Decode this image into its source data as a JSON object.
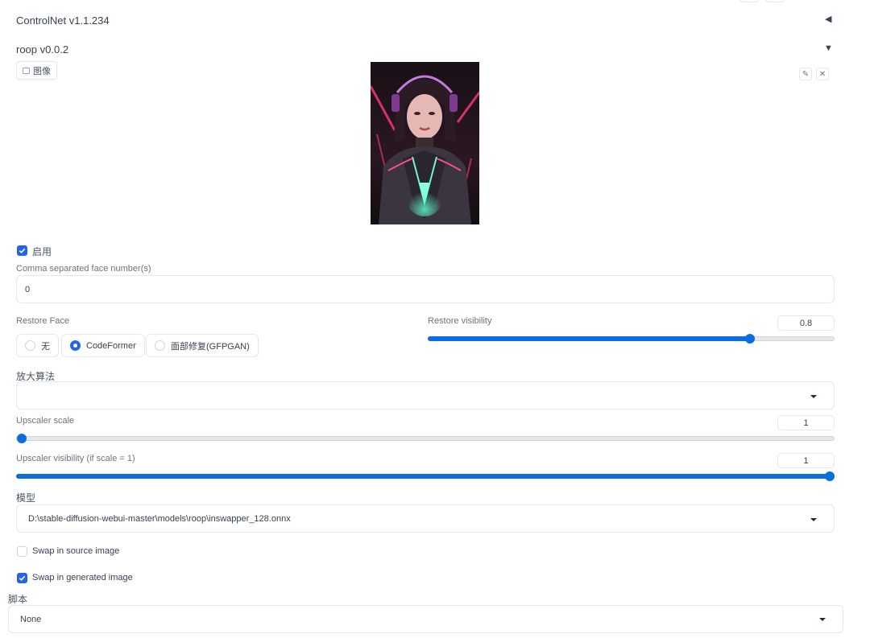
{
  "controlnet": {
    "title": "ControlNet v1.1.234",
    "collapse_icon": "triangle-left-icon"
  },
  "roop": {
    "title": "roop v0.0.2",
    "collapse_icon": "triangle-down-icon",
    "image_tab_label": "图像",
    "enable_label": "启用",
    "enable_checked": true,
    "face_number_label": "Comma separated face number(s)",
    "face_number_value": "0",
    "restore_face_label": "Restore Face",
    "restore_options": [
      "无",
      "CodeFormer",
      "面部修复(GFPGAN)"
    ],
    "restore_selected": "CodeFormer",
    "restore_visibility_label": "Restore visibility",
    "restore_visibility_value": "0.8",
    "upscaler_label": "放大算法",
    "upscaler_value": "",
    "upscaler_scale_label": "Upscaler scale",
    "upscaler_scale_value": "1",
    "upscaler_visibility_label": "Upscaler visibility (if scale = 1)",
    "upscaler_visibility_value": "1",
    "model_label": "模型",
    "model_value": "D:\\stable-diffusion-webui-master\\models\\roop\\inswapper_128.onnx",
    "swap_source_label": "Swap in source image",
    "swap_source_checked": false,
    "swap_generated_label": "Swap in generated image",
    "swap_generated_checked": true
  },
  "script": {
    "label": "脚本",
    "value": "None"
  },
  "colors": {
    "accent": "#2563eb",
    "slider": "#0b6ee0"
  }
}
